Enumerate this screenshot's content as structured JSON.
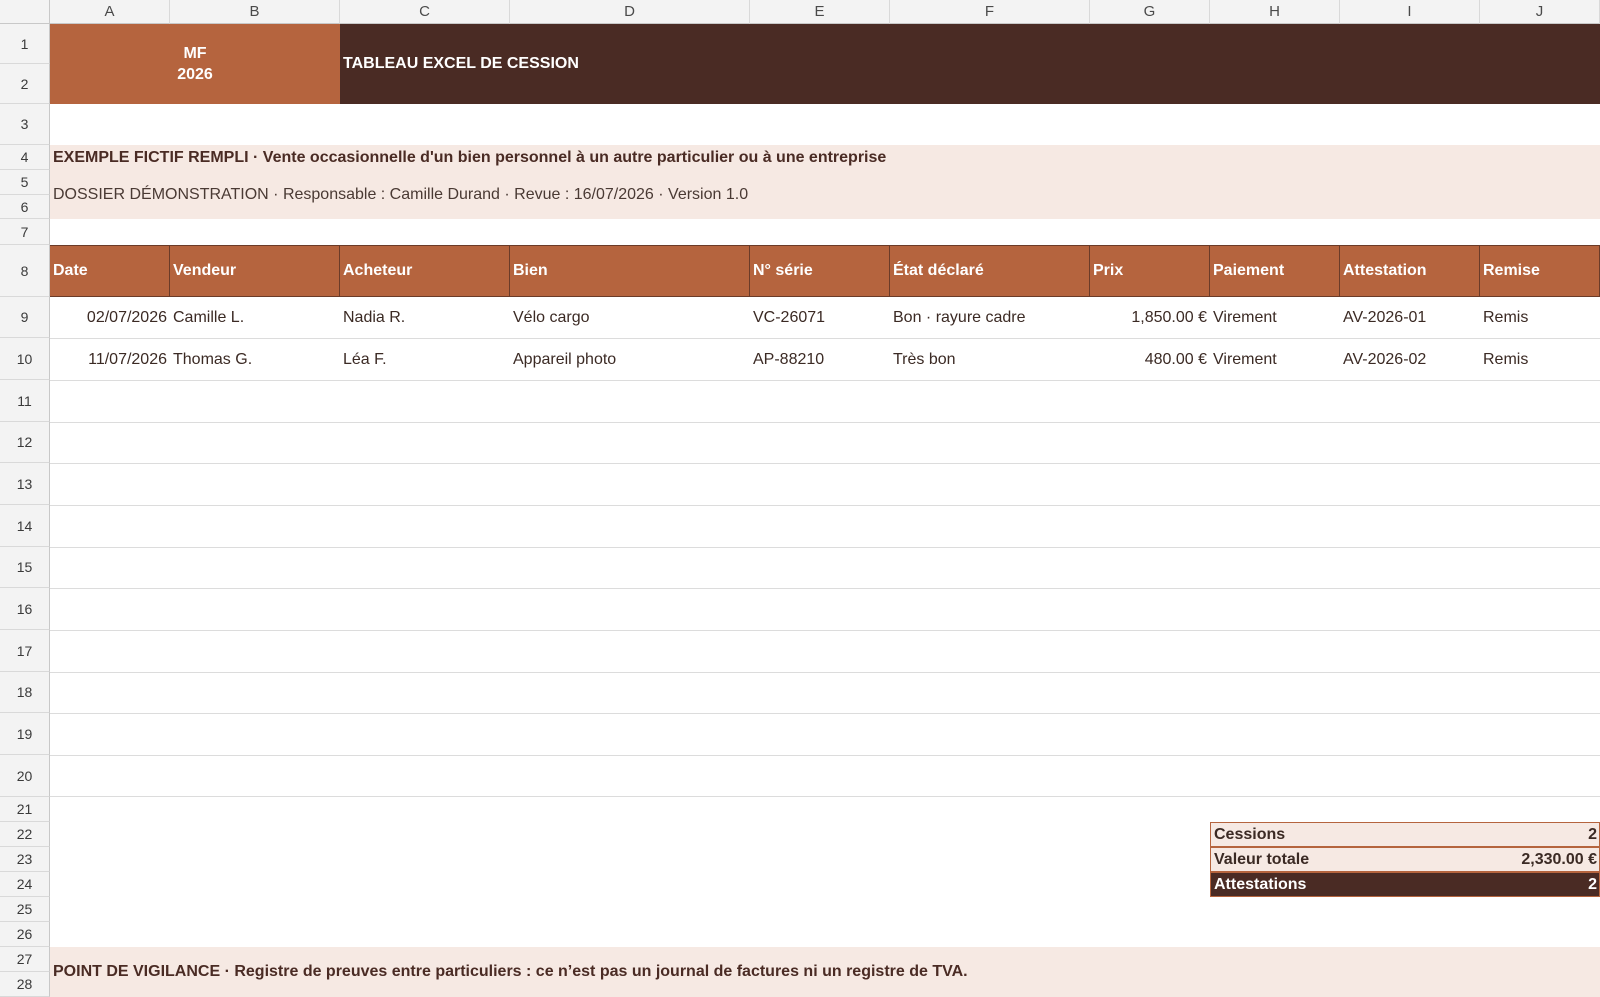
{
  "columns": [
    "A",
    "B",
    "C",
    "D",
    "E",
    "F",
    "G",
    "H",
    "I",
    "J"
  ],
  "rows": [
    "1",
    "2",
    "3",
    "4",
    "5",
    "6",
    "7",
    "8",
    "9",
    "10",
    "11",
    "12",
    "13",
    "14",
    "15",
    "16",
    "17",
    "18",
    "19",
    "20",
    "21",
    "22",
    "23",
    "24",
    "25",
    "26",
    "27",
    "28"
  ],
  "header": {
    "mf_label": "MF",
    "year": "2026",
    "title": "TABLEAU EXCEL DE CESSION"
  },
  "intro": {
    "line1": "EXEMPLE FICTIF REMPLI · Vente occasionnelle d'un bien personnel à un autre particulier ou à une entreprise",
    "line2": "DOSSIER DÉMONSTRATION · Responsable : Camille Durand · Revue : 16/07/2026 · Version 1.0"
  },
  "table": {
    "headers": [
      "Date",
      "Vendeur",
      "Acheteur",
      "Bien",
      "N° série",
      "État déclaré",
      "Prix",
      "Paiement",
      "Attestation",
      "Remise"
    ],
    "rows": [
      [
        "02/07/2026",
        "Camille L.",
        "Nadia R.",
        "Vélo cargo",
        "VC-26071",
        "Bon · rayure cadre",
        "1,850.00 €",
        "Virement",
        "AV-2026-01",
        "Remis"
      ],
      [
        "11/07/2026",
        "Thomas G.",
        "Léa F.",
        "Appareil photo",
        "AP-88210",
        "Très bon",
        "480.00 €",
        "Virement",
        "AV-2026-02",
        "Remis"
      ]
    ]
  },
  "summary": {
    "cessions_label": "Cessions",
    "cessions_value": "2",
    "total_label": "Valeur totale",
    "total_value": "2,330.00 €",
    "attest_label": "Attestations",
    "attest_value": "2"
  },
  "vigilance": "POINT DE VIGILANCE · Registre de preuves entre particuliers : ce n’est pas un journal de factures ni un registre de TVA.",
  "colors": {
    "accent": "#b5643e",
    "dark": "#4a2b24",
    "light": "#f6e9e3"
  }
}
